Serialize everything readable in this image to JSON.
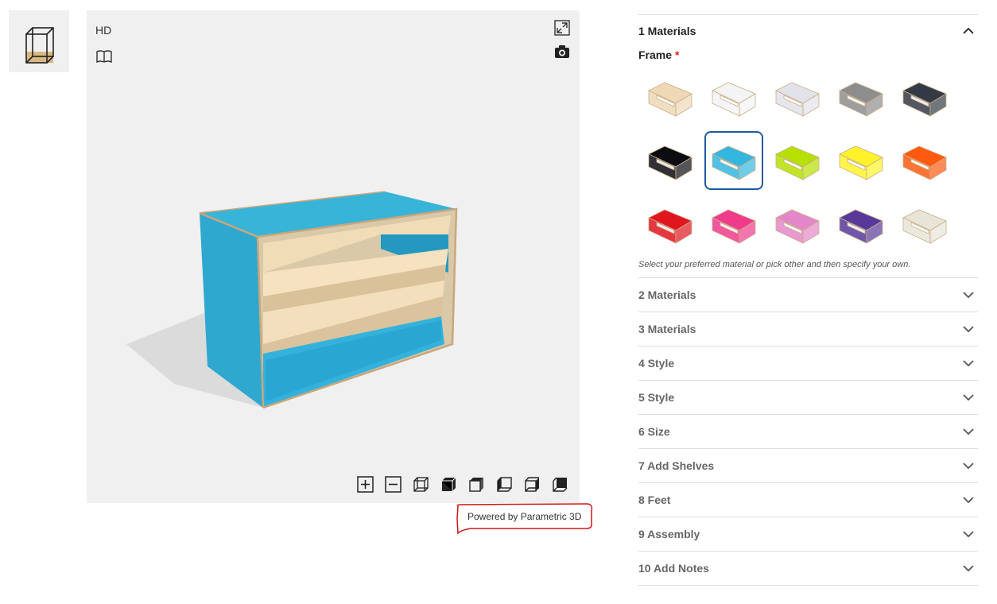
{
  "viewer": {
    "hd_label": "HD",
    "powered_by": "Powered by Parametric 3D",
    "cabinet_color": "#2fa8d0",
    "shelf_color": "#efd8b5",
    "view_buttons": [
      "zoom-in-icon",
      "zoom-out-icon",
      "wireframe-cube-icon",
      "solid-cube-icon",
      "front-view-icon",
      "left-view-icon",
      "right-view-icon",
      "back-view-icon"
    ]
  },
  "panel": {
    "sections": [
      {
        "label": "1 Materials",
        "open": true
      },
      {
        "label": "2 Materials"
      },
      {
        "label": "3 Materials"
      },
      {
        "label": "4 Style"
      },
      {
        "label": "5 Style"
      },
      {
        "label": "6 Size"
      },
      {
        "label": "7 Add Shelves"
      },
      {
        "label": "8 Feet"
      },
      {
        "label": "9 Assembly"
      },
      {
        "label": "10 Add Notes"
      }
    ],
    "frame_label": "Frame",
    "required_mark": "*",
    "hint": "Select your preferred material or pick other and then specify your own.",
    "selected_swatch": 6,
    "swatches": [
      {
        "color": "#efd8b5"
      },
      {
        "color": "#f4f4f4"
      },
      {
        "color": "#e2e2ea"
      },
      {
        "color": "#8d8d8d"
      },
      {
        "color": "#343a45"
      },
      {
        "color": "#0c0c12"
      },
      {
        "color": "#33b6e0"
      },
      {
        "color": "#b6e000"
      },
      {
        "color": "#fff22a"
      },
      {
        "color": "#ff5a10"
      },
      {
        "color": "#e0151e"
      },
      {
        "color": "#f03a8a"
      },
      {
        "color": "#e487c8"
      },
      {
        "color": "#57399a"
      },
      {
        "color": "#e8e4d8"
      }
    ]
  }
}
